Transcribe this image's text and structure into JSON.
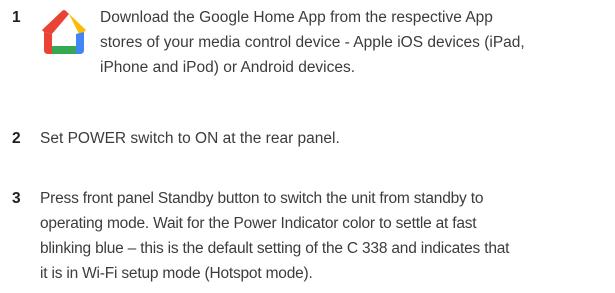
{
  "steps": [
    {
      "number": "1",
      "lines": [
        "Download the Google Home App from the respective App",
        "stores of your media control device - Apple iOS devices (iPad,",
        "iPhone and iPod) or Android devices."
      ],
      "icon": "google-home-app-icon"
    },
    {
      "number": "2",
      "lines": [
        "Set POWER switch to ON at the rear panel."
      ]
    },
    {
      "number": "3",
      "lines": [
        "Press front panel Standby button to switch the unit from standby to",
        "operating mode. Wait for the Power Indicator color to settle at fast",
        "blinking blue – this is the default setting of the C 338 and indicates that",
        "it is in Wi-Fi setup mode (Hotspot mode)."
      ]
    }
  ],
  "colors": {
    "text": "#3c3c3c",
    "number": "#1f1f1f",
    "logo_red": "#ea4335",
    "logo_yellow": "#fbbc04",
    "logo_green": "#34a853",
    "logo_blue": "#4285f4"
  }
}
